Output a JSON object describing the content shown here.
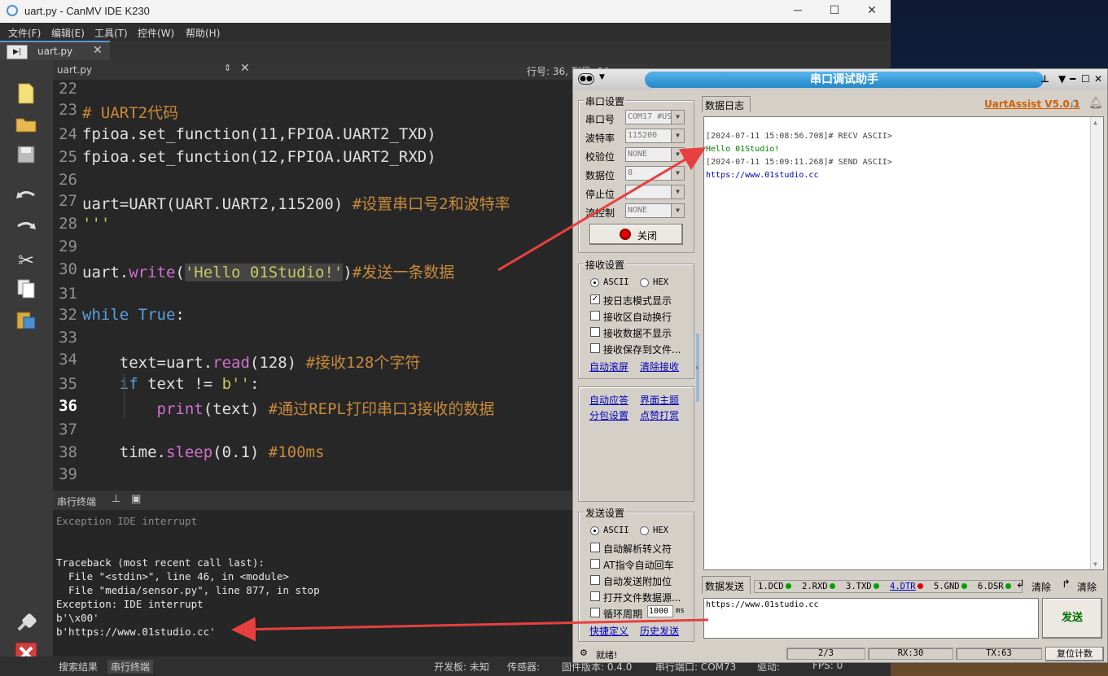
{
  "ide": {
    "window_title": "uart.py - CanMV IDE K230",
    "menu": [
      "文件(F)",
      "编辑(E)",
      "工具(T)",
      "控件(W)",
      "帮助(H)"
    ],
    "tab_name": "uart.py",
    "editor_file": "uart.py",
    "editor_pos": "行号: 36, 列号: 30",
    "code_lines": [
      {
        "num": "22",
        "html": ""
      },
      {
        "num": "23",
        "html": "<span class='cm'># UART2代码</span>"
      },
      {
        "num": "24",
        "html": "fpioa.set_function(11,FPIOA.UART2_TXD)"
      },
      {
        "num": "25",
        "html": "fpioa.set_function(12,FPIOA.UART2_RXD)"
      },
      {
        "num": "26",
        "html": ""
      },
      {
        "num": "27",
        "html": "uart=UART(UART.UART2,115200) <span class='cm'>#设置串口号2和波特率</span>"
      },
      {
        "num": "28",
        "html": "<span class='st'>'''</span>"
      },
      {
        "num": "29",
        "html": ""
      },
      {
        "num": "30",
        "html": "uart.<span class='fn'>write</span>(<span class='st hl'>'Hello 01Studio!'</span>)<span class='cm'>#发送一条数据</span>"
      },
      {
        "num": "31",
        "html": ""
      },
      {
        "num": "32",
        "html": "<span class='kw'>while</span> <span class='kw'>True</span>:"
      },
      {
        "num": "33",
        "html": ""
      },
      {
        "num": "34",
        "html": "    text=uart.<span class='fn'>read</span>(128) <span class='cm'>#接收128个字符</span>"
      },
      {
        "num": "35",
        "html": "    <span class='kw'>if</span> text != <span class='st'>b''</span>:"
      },
      {
        "num": "36",
        "html": "        <span class='fn'>print</span>(text) <span class='cm'>#通过REPL打印串口3接收的数据</span>"
      },
      {
        "num": "37",
        "html": ""
      },
      {
        "num": "38",
        "html": "    time.<span class='fn'>sleep</span>(0.1) <span class='cm'>#100ms</span>"
      },
      {
        "num": "39",
        "html": ""
      }
    ],
    "terminal_label": "串行终端",
    "terminal_lines": [
      "Exception IDE interrupt",
      "",
      "",
      "Traceback (most recent call last):",
      "  File \"<stdin>\", line 46, in <module>",
      "  File \"media/sensor.py\", line 877, in stop",
      "Exception: IDE interrupt",
      "b'\\x00'",
      "b'https://www.01studio.cc'"
    ],
    "status": {
      "search_tab": "搜索结果",
      "terminal_tab": "串行终端",
      "board": "开发板: 未知",
      "sensor": "传感器:",
      "firmware": "固件版本: 0.4.0",
      "serial": "串行端口: COM73",
      "drive": "驱动:",
      "fps": "FPS: 0"
    }
  },
  "ua": {
    "title": "串口调试助手",
    "brand": "UartAssist V5.0.1",
    "port_group": "串口设置",
    "port_label": "串口号",
    "port_value": "COM17 #US",
    "baud_label": "波特率",
    "baud_value": "115200",
    "parity_label": "校验位",
    "parity_value": "NONE",
    "data_label": "数据位",
    "data_value": "8",
    "stop_label": "停止位",
    "stop_value": "",
    "flow_label": "流控制",
    "flow_value": "NONE",
    "close_btn": "关闭",
    "recv_group": "接收设置",
    "ascii": "ASCII",
    "hex": "HEX",
    "recv_opts": [
      "按日志模式显示",
      "接收区自动换行",
      "接收数据不显示",
      "接收保存到文件..."
    ],
    "recv_checked": [
      true,
      false,
      false,
      false
    ],
    "auto_scroll": "自动滚屏",
    "clear_recv": "清除接收",
    "auto_reply": "自动应答",
    "theme": "界面主题",
    "packet": "分包设置",
    "reward": "点赞打赏",
    "send_group": "发送设置",
    "send_opts": [
      "自动解析转义符",
      "AT指令自动回车",
      "自动发送附加位",
      "打开文件数据源...",
      "循环周期"
    ],
    "cycle_value": "1000",
    "cycle_unit": "ms",
    "shortcut": "快捷定义",
    "history": "历史发送",
    "log_tab": "数据日志",
    "log_lines": [
      {
        "text": "[2024-07-11 15:08:56.708]# RECV ASCII>",
        "color": "#444444"
      },
      {
        "text": "Hello 01Studio!",
        "color": "#008000"
      },
      {
        "text": "[2024-07-11 15:09:11.268]# SEND ASCII>",
        "color": "#444444"
      },
      {
        "text": "https://www.01studio.cc",
        "color": "#0000c0"
      }
    ],
    "send_tab": "数据发送",
    "pins": [
      "1.DCD",
      "2.RXD",
      "3.TXD",
      "4.DTR",
      "5.GND",
      "6.DSR"
    ],
    "pin_colors": [
      "#00a000",
      "#00a000",
      "#00a000",
      "#e00000",
      "#00a000",
      "#00a000"
    ],
    "clear1": "清除",
    "clear2": "清除",
    "send_text": "https://www.01studio.cc",
    "send_btn": "发送",
    "status_ready": "就绪!",
    "counter": "2/3",
    "rx": "RX:30",
    "tx": "TX:63",
    "reset": "复位计数"
  }
}
